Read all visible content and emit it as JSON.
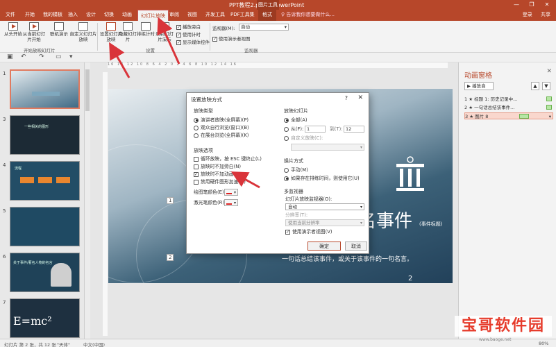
{
  "window": {
    "title": "PPT教程2.pptx - PowerPoint",
    "context_group": "图片工具",
    "minimize": "—",
    "restore": "❐",
    "close": "✕"
  },
  "tabs": [
    "文件",
    "开始",
    "我的模板",
    "插入",
    "设计",
    "切换",
    "动画",
    "幻灯片放映",
    "审阅",
    "视图",
    "开发工具",
    "PDF工具集",
    "格式"
  ],
  "active_tab": "幻灯片放映",
  "tell_me": "告诉我你想要做什么...",
  "account": {
    "login": "登录",
    "share": "共享"
  },
  "ribbon": {
    "from_start": "从头开始",
    "from_current": "从当前幻灯片开始",
    "present_online": "联机演示",
    "custom_show": "自定义幻灯片放映",
    "group_start": "开始放映幻灯片",
    "setup_show": "设置幻灯片放映",
    "hide_slide": "隐藏幻灯片",
    "rehearse": "排练计时",
    "record": "录制幻灯片演示",
    "chk_narration": "播放旁白",
    "chk_timing": "使用计时",
    "chk_media": "显示媒体控件",
    "group_setup": "设置",
    "monitor_label": "监视器(M):",
    "monitor_value": "自动",
    "chk_presenter": "使用演示者视图",
    "group_monitor": "监视器"
  },
  "thumbnails": [
    {
      "num": "1",
      "text": ""
    },
    {
      "num": "3",
      "text": "一些相关的图形"
    },
    {
      "num": "4",
      "text": "流程"
    },
    {
      "num": "5",
      "text": ""
    },
    {
      "num": "6",
      "text": "关于事件/著名人物的名言"
    },
    {
      "num": "7",
      "text": "E=mc²"
    }
  ],
  "slide": {
    "title": "名事件",
    "subtitle": "(事件标题)",
    "body": "一句话总结该事件，或关于该事件的一句名言。",
    "number": "2",
    "ph1": "1",
    "ph2": "2"
  },
  "ruler": "16  14  12  10  8  6  4  2  0  2  4  6  8  10  12  14  16",
  "animation_pane": {
    "title": "动画窗格",
    "close": "✕",
    "play": "▶ 播放自",
    "up": "▲",
    "down": "▼",
    "items": [
      {
        "num": "1",
        "label": "标题 1: 历史记录中..."
      },
      {
        "num": "2",
        "label": "一句话总结该事件..."
      },
      {
        "num": "3",
        "label": "图片 8"
      }
    ]
  },
  "dialog": {
    "title": "设置放映方式",
    "help": "?",
    "close": "✕",
    "show_type_label": "放映类型",
    "show_type": [
      "演讲者放映(全屏幕)(P)",
      "观众自行浏览(窗口)(B)",
      "在展台浏览(全屏幕)(K)"
    ],
    "options_label": "放映选项",
    "options": [
      "循环放映，按 ESC 键终止(L)",
      "放映时不加旁白(N)",
      "放映时不加动画(S)",
      "禁用硬件图形加速(G)"
    ],
    "pen_color": "绘图笔颜色(E):",
    "laser_color": "激光笔颜色(R):",
    "slides_label": "放映幻灯片",
    "all": "全部(A)",
    "from": "从(F):",
    "from_value": "1",
    "to": "到(T):",
    "to_value": "12",
    "custom": "自定义放映(C):",
    "advance_label": "换片方式",
    "manual": "手动(M)",
    "timings": "如果存在排练时间，则使用它(U)",
    "multi_monitor_label": "多监视器",
    "monitor_label": "幻灯片放映监视器(O):",
    "monitor_value": "自动",
    "resolution_label": "分辨率(T):",
    "resolution_value": "使用当前分辨率",
    "presenter_view": "使用演示者视图(V)",
    "ok": "确定",
    "cancel": "取消"
  },
  "status": {
    "slide_info": "幻灯片 第 2 张，共 12 张",
    "theme": "\"天体\"",
    "language": "中文(中国)",
    "zoom": "80%"
  },
  "watermark": {
    "text": "宝哥软件园",
    "url": "www.baoge.net"
  },
  "colors": {
    "accent": "#b7472a",
    "arrow": "#d9343a",
    "slide_dark": "#22415a"
  }
}
